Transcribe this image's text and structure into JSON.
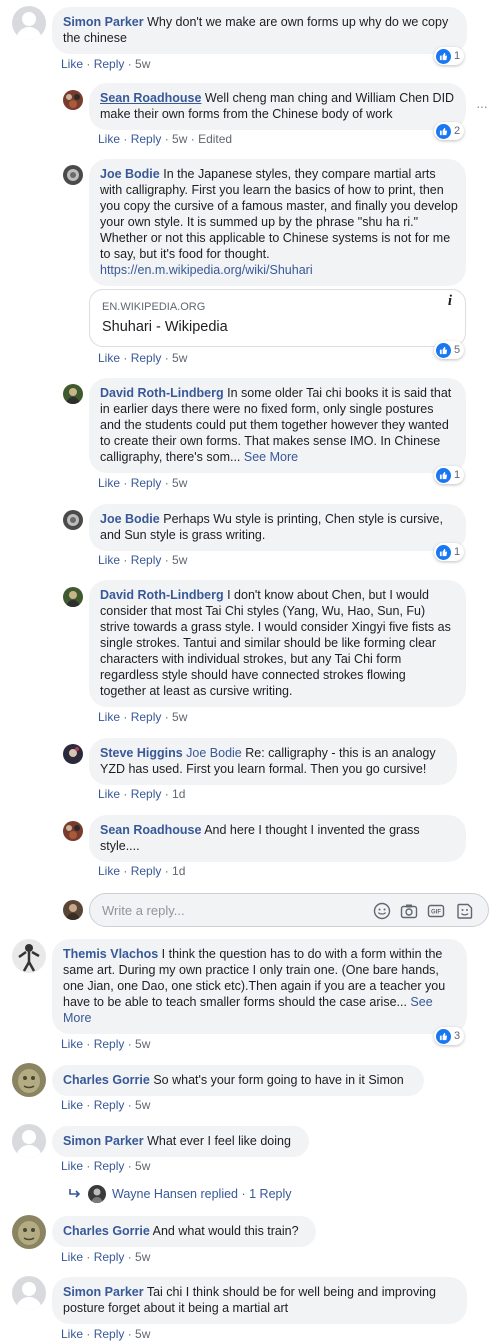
{
  "actions": {
    "like": "Like",
    "reply": "Reply",
    "edited": "Edited"
  },
  "comments": [
    {
      "author": "Simon Parker",
      "text": "Why don't we make are own forms up why do we copy the chinese",
      "time": "5w",
      "reactions": "1"
    },
    {
      "author": "Sean Roadhouse",
      "text": "Well cheng man ching and William Chen DID make their own forms from the Chinese body of work",
      "time": "5w",
      "reactions": "2"
    },
    {
      "author": "Joe Bodie",
      "text": "In the Japanese styles, they compare martial arts with calligraphy. First you learn the basics of how to print, then you copy the cursive of a famous master, and finally you develop your own style. It is summed up by the phrase \"shu ha ri.\" Whether or not this applicable to Chinese systems is not for me to say, but it's food for thought.",
      "link": "https://en.m.wikipedia.org/wiki/Shuhari",
      "time": "5w",
      "reactions": "5",
      "preview": {
        "domain": "EN.WIKIPEDIA.ORG",
        "title": "Shuhari - Wikipedia"
      }
    },
    {
      "author": "David Roth-Lindberg",
      "text": "In some older Tai chi books it is said that in earlier days there were no fixed form, only single postures and the students could put them together however they wanted to create their own forms. That makes sense IMO. In Chinese calligraphy, there's som...",
      "see_more": "See More",
      "time": "5w",
      "reactions": "1"
    },
    {
      "author": "Joe Bodie",
      "text": "Perhaps Wu style is printing, Chen style is cursive, and Sun style is grass writing.",
      "time": "5w",
      "reactions": "1"
    },
    {
      "author": "David Roth-Lindberg",
      "text": "I don't know about Chen, but I would consider that most Tai Chi styles (Yang, Wu, Hao, Sun, Fu) strive towards a grass style. I would consider Xingyi five fists as single strokes. Tantui and similar should be like forming clear characters with individual strokes, but any Tai Chi form regardless style should have connected strokes flowing together at least as cursive writing.",
      "time": "5w"
    },
    {
      "author": "Steve Higgins",
      "mention": "Joe Bodie",
      "text": "Re: calligraphy - this is an analogy YZD has used. First you learn formal. Then you go cursive!",
      "time": "1d"
    },
    {
      "author": "Sean Roadhouse",
      "text": "And here I thought I invented the grass style....",
      "time": "1d"
    },
    {
      "author": "Themis Vlachos",
      "text": "I think the question has to do with a form within the same art. During my own practice I only train one. (One bare hands, one Jian, one Dao, one stick etc).Then again if you are a teacher you have to be able to teach smaller forms should the case arise...",
      "see_more": "See More",
      "time": "5w",
      "reactions": "3"
    },
    {
      "author": "Charles Gorrie",
      "text": "So what's your form going to have in it Simon",
      "time": "5w"
    },
    {
      "author": "Simon Parker",
      "text": "What ever I feel like doing",
      "time": "5w"
    },
    {
      "author": "Charles Gorrie",
      "text": "And what would this train?",
      "time": "5w"
    },
    {
      "author": "Simon Parker",
      "text": "Tai chi I think should be for well being and improving posture forget about it being a martial art",
      "time": "5w"
    }
  ],
  "reply_box": {
    "placeholder": "Write a reply..."
  },
  "replied": {
    "name": "Wayne Hansen",
    "text": "replied",
    "count": "1 Reply"
  },
  "colors": {
    "link": "#385898",
    "bubble": "#f2f3f5",
    "like_blue": "#1877f2",
    "meta_gray": "#606770"
  }
}
